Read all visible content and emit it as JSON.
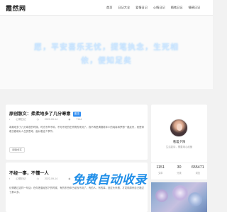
{
  "site": {
    "logo": "霞然网"
  },
  "nav": {
    "items": [
      {
        "label": "首页"
      },
      {
        "label": "日记大全"
      },
      {
        "label": "爱情日记"
      },
      {
        "label": "心情日记"
      },
      {
        "label": "随笔日记"
      },
      {
        "label": "情感日记"
      }
    ]
  },
  "hero": {
    "line1": "愿，平安喜乐无忧，提笔执念，生死相",
    "line2": "依，便知足矣"
  },
  "posts": [
    {
      "title": "原创散文：柔柔地多了几分寒意",
      "badge": "置顶",
      "category": "心情日记",
      "date": "2022-09-14",
      "views": "7164",
      "excerpt": "寒柔地多了几分寒意的时候，时光不声不响，不知不觉的在悄悄的来到了。我不再是满载着年少的纯真和梦想一路走来，而是带着沉稳和对人生的思考，面对着这个季节。",
      "more_label": "阅读全文"
    },
    {
      "title": "不经一事，不懂一人",
      "category": "心情日记",
      "date": "2022-09-14",
      "views": "7164",
      "excerpt": "记得看过这样一句话：在你把曾经放下的时候，有的东西你已经找不到了。有的人，有的事，回过头来看，才发现原来自己错过了那么多。"
    }
  ],
  "profile": {
    "name": "看着夕阳",
    "motto": "生活如诗，需要用心经营"
  },
  "stats": [
    {
      "num": "1151",
      "label": "文章"
    },
    {
      "num": "30",
      "label": "分类"
    },
    {
      "num": "655471",
      "label": "浏览"
    }
  ],
  "watermark": "免费自动收录",
  "colors": {
    "accent": "#2f8cf0",
    "watermark": "#1f8ee8",
    "hero_text": "#cfe7ff"
  },
  "icons": {
    "calendar": "calendar-icon",
    "eye": "eye-icon",
    "folder": "folder-icon"
  }
}
